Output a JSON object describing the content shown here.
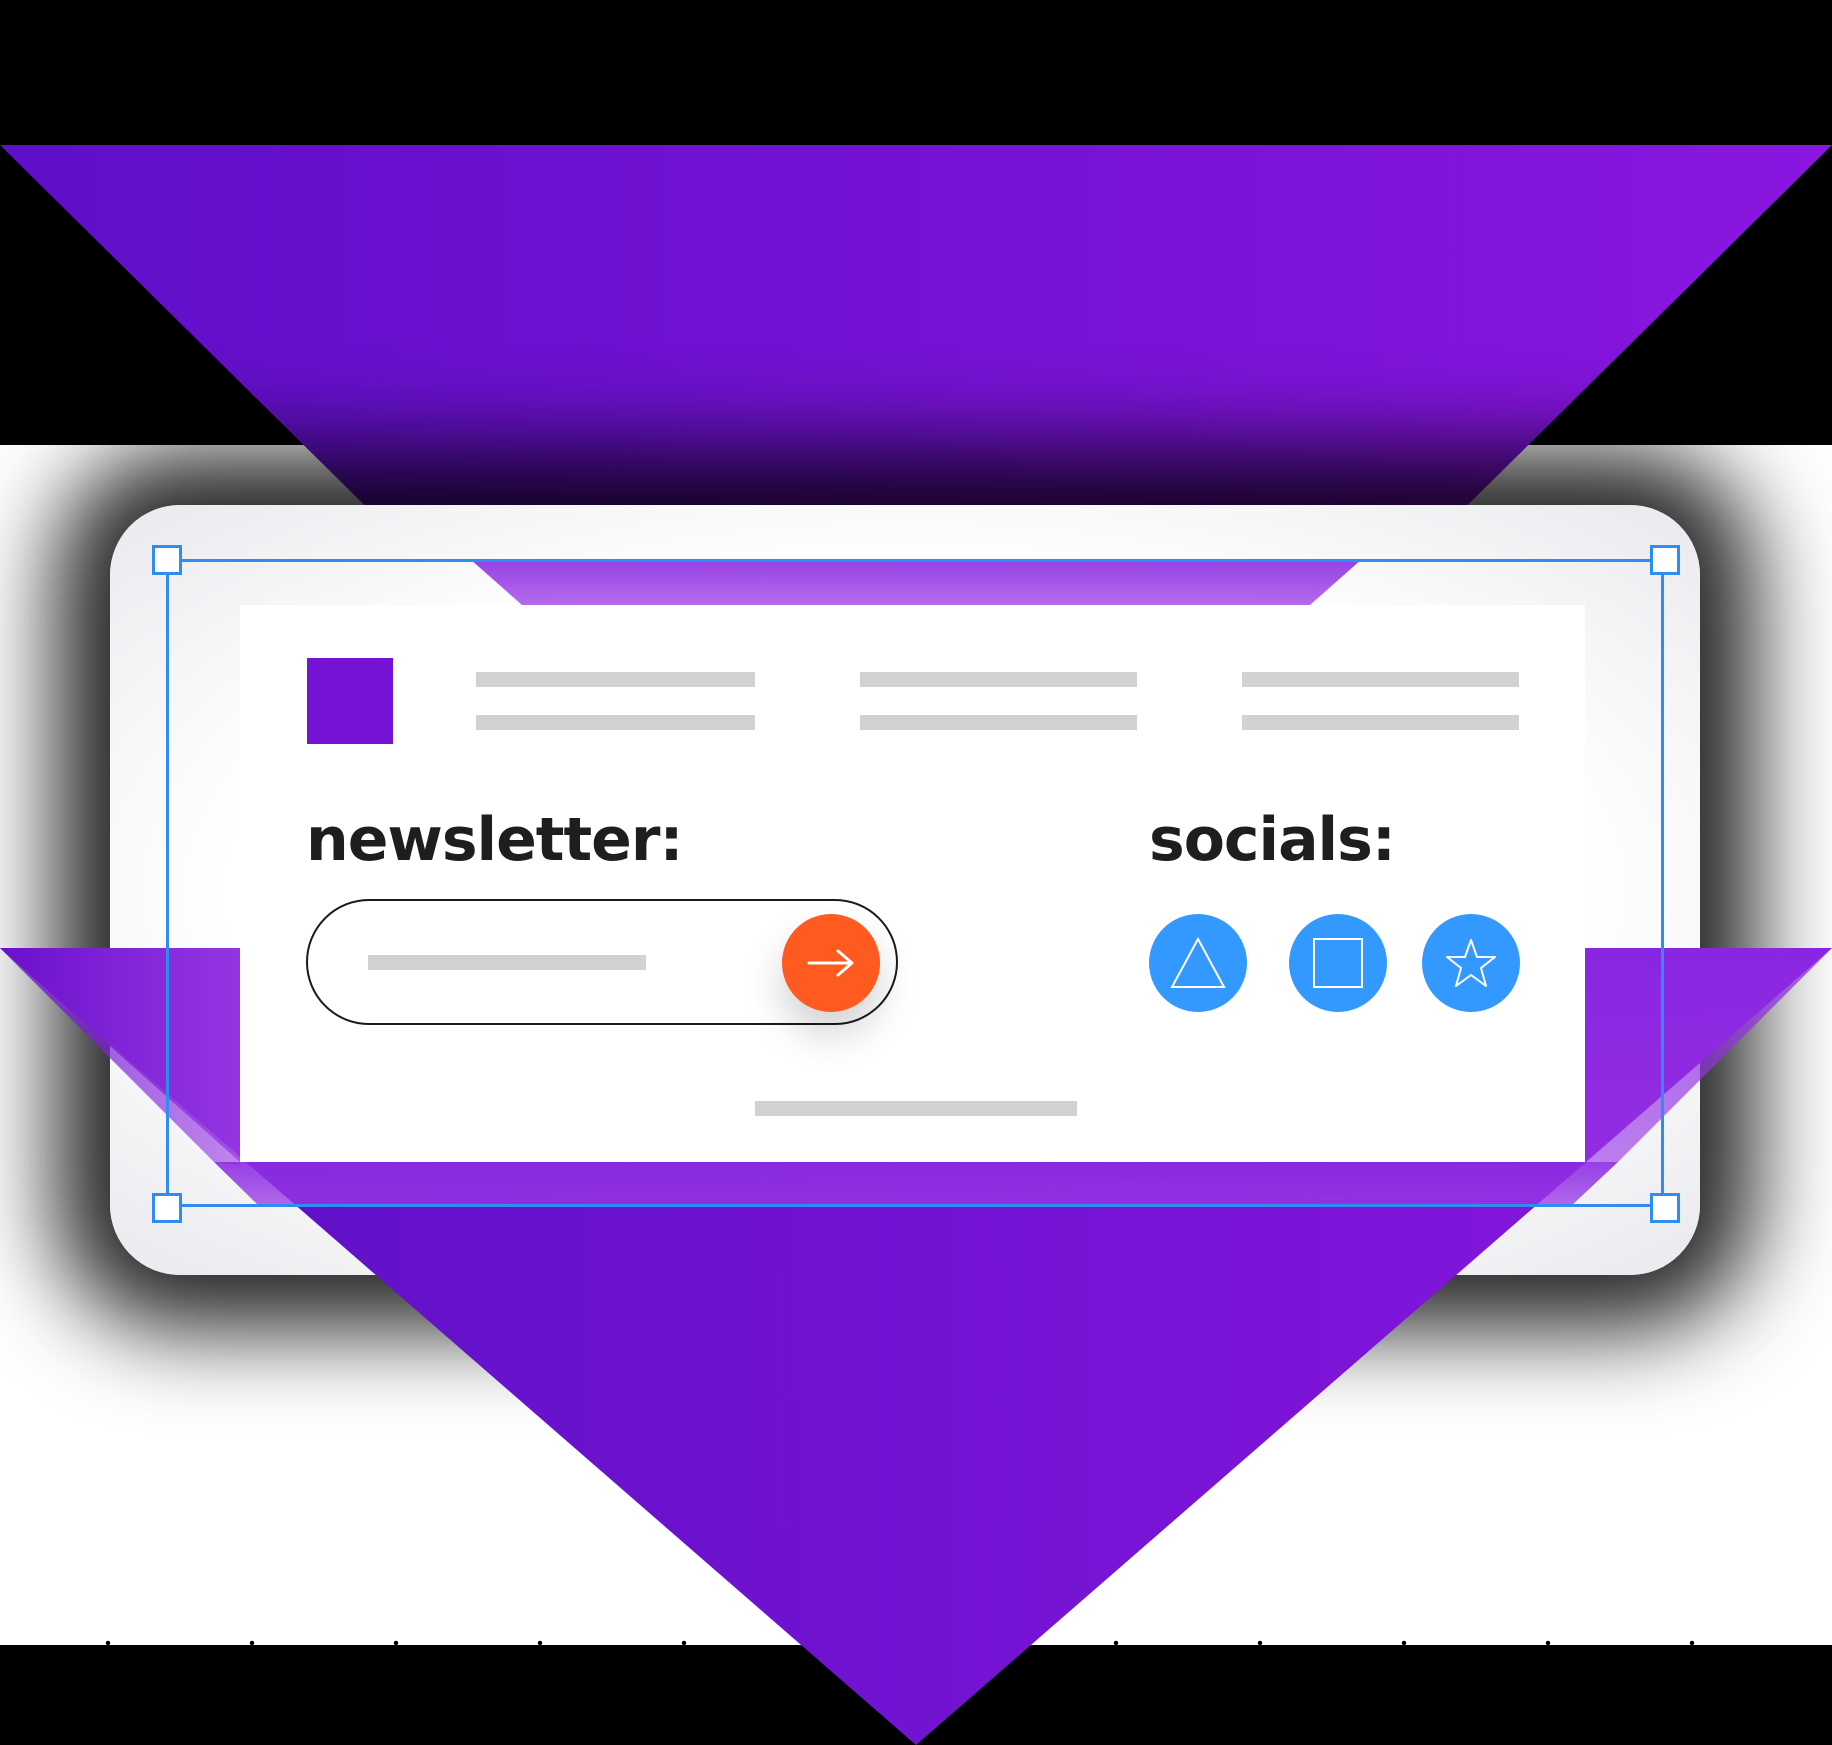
{
  "colors": {
    "brand_purple": "#7412d6",
    "purple_dark": "#5f0fc8",
    "purple_light": "#8a16e0",
    "submit_orange": "#ff5a1f",
    "social_blue": "#3399ff",
    "selection_blue": "#2f8cf0",
    "placeholder_gray": "#d2d2d2",
    "heading_text": "#1e1e1e"
  },
  "header": {
    "logo": "brand-square",
    "nav_placeholders": 3
  },
  "newsletter": {
    "title": "newsletter:",
    "input_placeholder": "",
    "submit_icon": "arrow-right-icon"
  },
  "socials": {
    "title": "socials:",
    "items": [
      {
        "icon": "triangle-icon"
      },
      {
        "icon": "square-icon"
      },
      {
        "icon": "star-icon"
      }
    ]
  },
  "selection": {
    "handles": [
      "top-left",
      "top-right",
      "bottom-left",
      "bottom-right"
    ]
  }
}
